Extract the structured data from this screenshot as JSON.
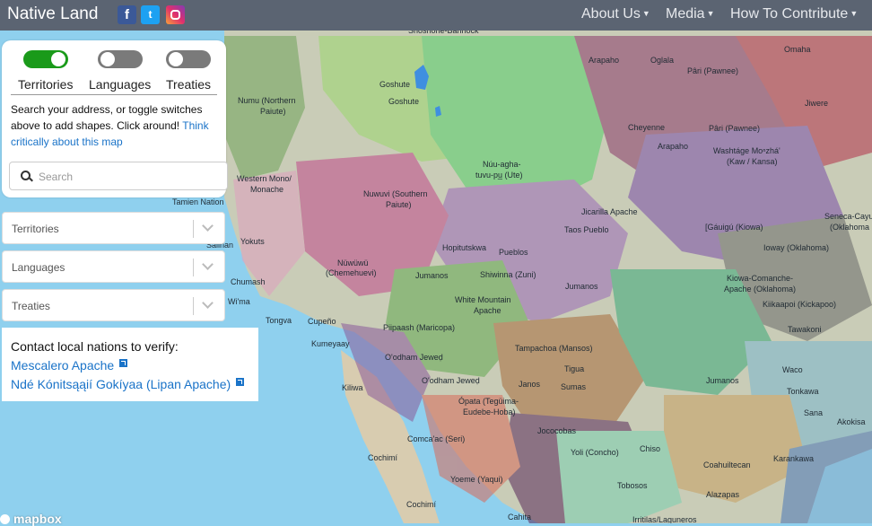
{
  "header": {
    "brand": "Native Land",
    "social": {
      "facebook": "f",
      "twitter": "t"
    },
    "nav": [
      {
        "label": "About Us"
      },
      {
        "label": "Media"
      },
      {
        "label": "How To Contribute"
      }
    ]
  },
  "panel": {
    "toggles": [
      {
        "label": "Territories",
        "state": "on"
      },
      {
        "label": "Languages",
        "state": "off"
      },
      {
        "label": "Treaties",
        "state": "off"
      }
    ],
    "instructions": "Search your address, or toggle switches above to add shapes. Click around!",
    "instructions_link": "Think critically about this map",
    "search_placeholder": "Search"
  },
  "dropdowns": [
    {
      "label": "Territories"
    },
    {
      "label": "Languages"
    },
    {
      "label": "Treaties"
    }
  ],
  "contact": {
    "title": "Contact local nations to verify:",
    "links": [
      "Mescalero Apache",
      "Ndé Kónitsąąií Gokíyaa (Lipan Apache)"
    ]
  },
  "attribution": "mapbox",
  "colors": {
    "navbar": "#5b6472",
    "toggle_on": "#1a9a1a",
    "toggle_off": "#7a7a7a",
    "link": "#1a73c8",
    "ocean": "#8fd0ee"
  },
  "map_labels": [
    {
      "text": "Shoshone-Bannock"
    },
    {
      "text": "Arapaho"
    },
    {
      "text": "Oglala"
    },
    {
      "text": "Omaha"
    },
    {
      "text": "Pâri (Pawnee)"
    },
    {
      "text": "Goshute"
    },
    {
      "text": "Goshute"
    },
    {
      "text": "Numu (Northern"
    },
    {
      "text": "Paiute)"
    },
    {
      "text": "Jiwere"
    },
    {
      "text": "Cheyenne"
    },
    {
      "text": "Pâri (Pawnee)"
    },
    {
      "text": "Arapaho"
    },
    {
      "text": "Washtáge Moⁿzhá'"
    },
    {
      "text": "(Kaw / Kansa)"
    },
    {
      "text": "Núu-agha-"
    },
    {
      "text": "tuvu-pu̲ (Ute)"
    },
    {
      "text": "Western Mono/"
    },
    {
      "text": "Monache"
    },
    {
      "text": "Nuwuvi (Southern"
    },
    {
      "text": "Paiute)"
    },
    {
      "text": "Tamien Nation"
    },
    {
      "text": "Jicarilla Apache"
    },
    {
      "text": "[Gáuigú (Kiowa)"
    },
    {
      "text": "Seneca-Cayu"
    },
    {
      "text": "(Oklahoma"
    },
    {
      "text": "Taos Pueblo"
    },
    {
      "text": "Yokuts"
    },
    {
      "text": "Salinan"
    },
    {
      "text": "Hopitutskwa"
    },
    {
      "text": "Pueblos"
    },
    {
      "text": "Ioway (Oklahoma)"
    },
    {
      "text": "Chumash"
    },
    {
      "text": "Nüwüwü"
    },
    {
      "text": "(Chemehuevi)"
    },
    {
      "text": "Jumanos"
    },
    {
      "text": "Shiwinna (Zuni)"
    },
    {
      "text": "Kiowa-Comanche-"
    },
    {
      "text": "Apache (Oklahoma)"
    },
    {
      "text": "Jumanos"
    },
    {
      "text": "White Mountain"
    },
    {
      "text": "Apache"
    },
    {
      "text": "Kiikaapoi (Kickapoo)"
    },
    {
      "text": "Wi'ma"
    },
    {
      "text": "Tongva"
    },
    {
      "text": "Cupeño"
    },
    {
      "text": "Piipaash (Maricopa)"
    },
    {
      "text": "Tawakoni"
    },
    {
      "text": "Kumeyaay"
    },
    {
      "text": "Tampachoa (Mansos)"
    },
    {
      "text": "O'odham Jeweḍ"
    },
    {
      "text": "Waco"
    },
    {
      "text": "Tigua"
    },
    {
      "text": "Kiliwa"
    },
    {
      "text": "O'odham Jeweḍ"
    },
    {
      "text": "Janos"
    },
    {
      "text": "Sumas"
    },
    {
      "text": "Jumanos"
    },
    {
      "text": "Tonkawa"
    },
    {
      "text": "Ópata (Tegüima-"
    },
    {
      "text": "Eudebe-Hoba)"
    },
    {
      "text": "Sana"
    },
    {
      "text": "Akokisa"
    },
    {
      "text": "Jococobas"
    },
    {
      "text": "Comca'ac (Seri)"
    },
    {
      "text": "Chiso"
    },
    {
      "text": "Yoli (Concho)"
    },
    {
      "text": "Cochimí"
    },
    {
      "text": "Karankawa"
    },
    {
      "text": "Coahuiltecan"
    },
    {
      "text": "Yoeme (Yaqui)"
    },
    {
      "text": "Tobosos"
    },
    {
      "text": "Alazapas"
    },
    {
      "text": "Cochimí"
    },
    {
      "text": "Cahita"
    },
    {
      "text": "Irritilas/Laguneros"
    }
  ]
}
